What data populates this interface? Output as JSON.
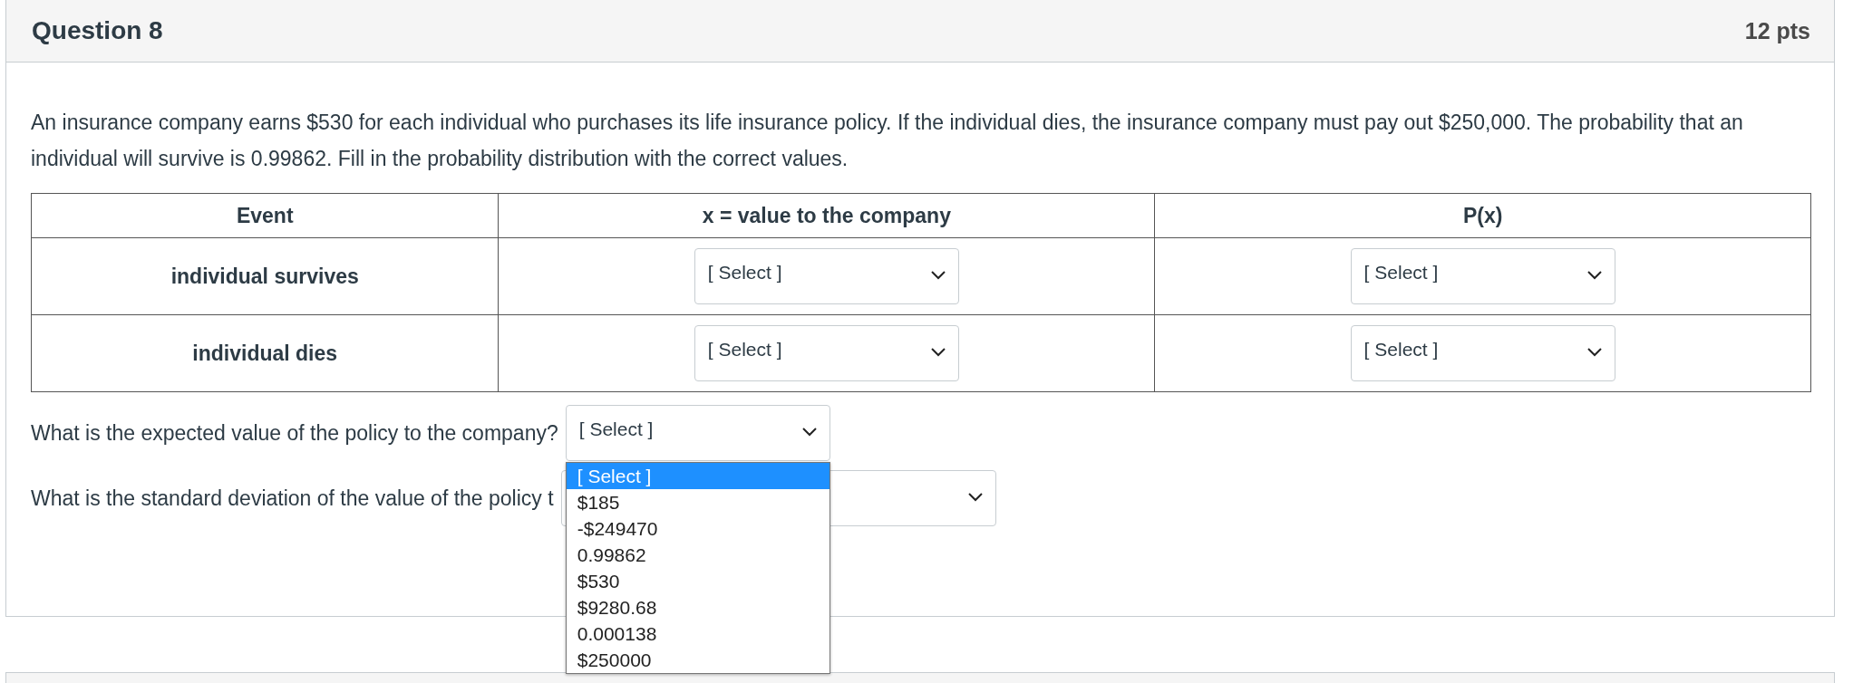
{
  "question": {
    "title": "Question 8",
    "points": "12 pts"
  },
  "prompt": "An insurance company earns $530 for each individual who purchases its life insurance policy. If the individual dies, the insurance company must pay out $250,000. The probability that an individual will survive is 0.99862. Fill in the probability distribution with the correct values.",
  "table": {
    "columns": [
      "Event",
      "x = value to the company",
      "P(x)"
    ],
    "rows": [
      {
        "event": "individual survives",
        "selects": [
          "[ Select ]",
          "[ Select ]"
        ]
      },
      {
        "event": "individual dies",
        "selects": [
          "[ Select ]",
          "[ Select ]"
        ]
      }
    ]
  },
  "questions": [
    {
      "text": "What is the expected value of the policy to the company?",
      "select": {
        "value": "[ Select ]",
        "expanded": true,
        "options": [
          {
            "label": "[ Select ]",
            "selected": true
          },
          {
            "label": "$185",
            "selected": false
          },
          {
            "label": "-$249470",
            "selected": false
          },
          {
            "label": "0.99862",
            "selected": false
          },
          {
            "label": "$530",
            "selected": false
          },
          {
            "label": "$9280.68",
            "selected": false
          },
          {
            "label": "0.000138",
            "selected": false
          },
          {
            "label": "$250000",
            "selected": false
          }
        ]
      }
    },
    {
      "text": "What is the standard deviation of the value of the policy t",
      "select": {
        "expanded": false
      }
    }
  ]
}
